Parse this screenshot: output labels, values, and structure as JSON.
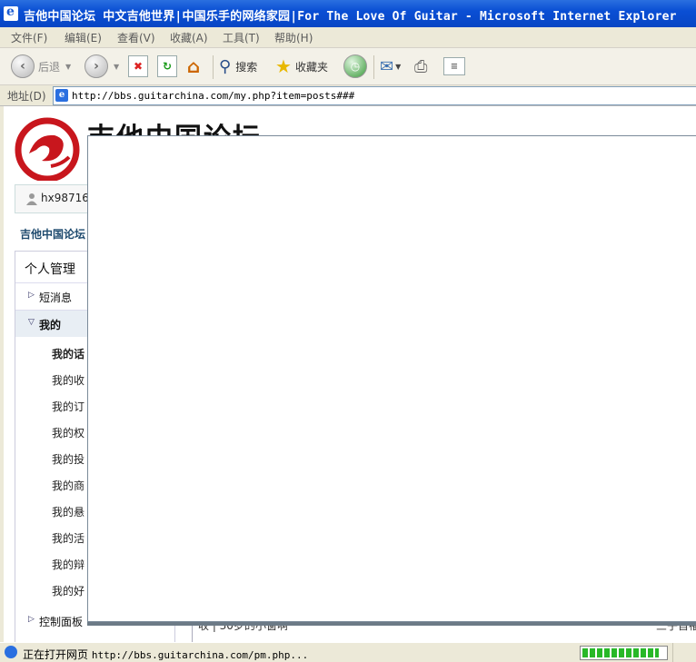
{
  "window": {
    "title": "吉他中国论坛 中文吉他世界|中国乐手的网络家园|For The Love Of Guitar - Microsoft Internet Explorer"
  },
  "menu": [
    "文件(F)",
    "编辑(E)",
    "查看(V)",
    "收藏(A)",
    "工具(T)",
    "帮助(H)"
  ],
  "toolbar": {
    "back_label": "后退",
    "search_label": "搜索",
    "favorites_label": "收藏夹"
  },
  "address": {
    "label": "地址(D)",
    "url": "http://bbs.guitarchina.com/my.php?item=posts###"
  },
  "page": {
    "site_title": "吉他中国论坛",
    "username": "hx98716",
    "breadcrumb": "吉他中国论坛",
    "panel_title": "个人管理",
    "sections": {
      "pm": "短消息",
      "mine": "我的",
      "control": "控制面板"
    },
    "mine_items": [
      "我的话",
      "我的收",
      "我的订",
      "我的权",
      "我的投",
      "我的商",
      "我的悬",
      "我的活",
      "我的辩",
      "我的好"
    ],
    "bottom_left_text": "收 | 30岁的小窗啊",
    "bottom_right_text": "三子旨福"
  },
  "status": {
    "text": "正在打开网页",
    "url": "http://bbs.guitarchina.com/pm.php...",
    "progress": 0.92
  },
  "colors": {
    "title_bar": "#0a4fd4",
    "chrome": "#ece9d8",
    "progress": "#28b828",
    "breadcrumb": "#1e4a6e"
  }
}
